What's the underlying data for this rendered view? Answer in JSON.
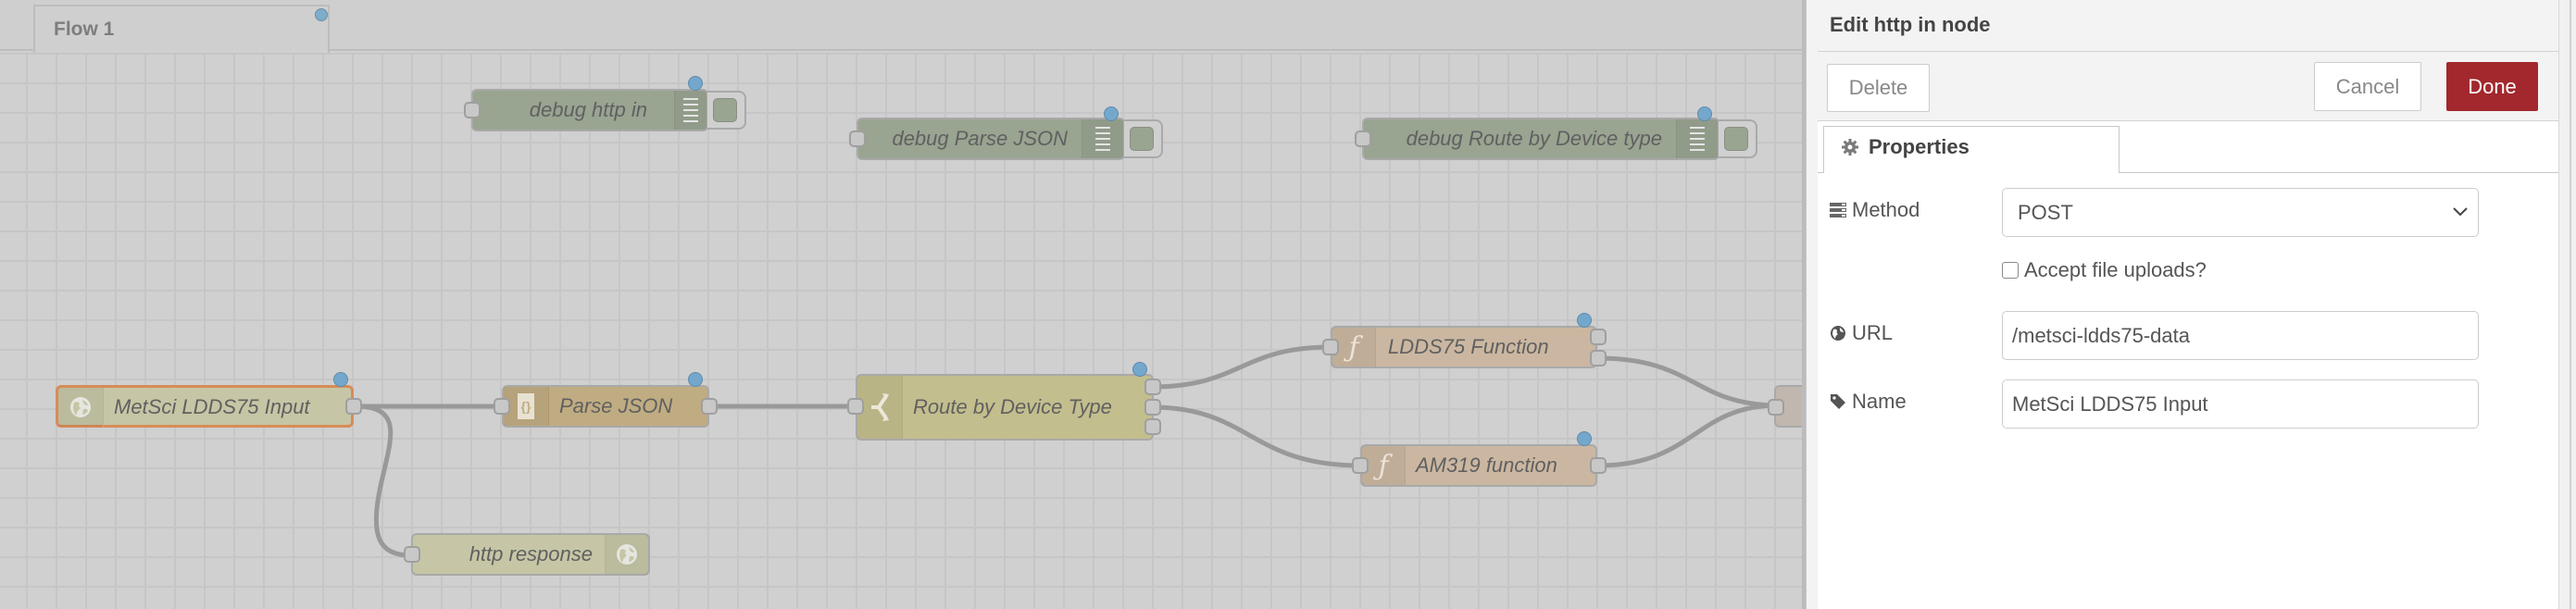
{
  "workspace": {
    "tabs": [
      {
        "label": "Flow 1",
        "changed": true
      }
    ]
  },
  "colors": {
    "canvas": "#d0d0d0",
    "node_http": "#c6c6a6",
    "node_json": "#c0ac82",
    "node_switch": "#c3be8e",
    "node_function": "#cbb7a1",
    "node_debug": "#99a491",
    "selected_border": "#d88c58",
    "status_dot": "#74a7cc",
    "done_button": "#a2282d"
  },
  "nodes": [
    {
      "id": "debug-http-in",
      "label": "debug http in",
      "type": "debug"
    },
    {
      "id": "debug-parse-json",
      "label": "debug Parse JSON",
      "type": "debug"
    },
    {
      "id": "debug-route",
      "label": "debug Route by Device type",
      "type": "debug"
    },
    {
      "id": "http-in",
      "label": "MetSci LDDS75 Input",
      "type": "http in",
      "selected": true
    },
    {
      "id": "parse-json",
      "label": "Parse JSON",
      "type": "json"
    },
    {
      "id": "route",
      "label": "Route by Device Type",
      "type": "switch",
      "outputs": 3
    },
    {
      "id": "ldds75-fn",
      "label": "LDDS75 Function",
      "type": "function",
      "outputs": 2
    },
    {
      "id": "am319-fn",
      "label": "AM319 function",
      "type": "function"
    },
    {
      "id": "http-response",
      "label": "http response",
      "type": "http response"
    }
  ],
  "panel": {
    "title": "Edit http in node",
    "buttons": {
      "delete": "Delete",
      "cancel": "Cancel",
      "done": "Done"
    },
    "tabs": {
      "properties": "Properties"
    },
    "form": {
      "method_label": "Method",
      "method_value": "POST",
      "accept_uploads_label": "Accept file uploads?",
      "accept_uploads_checked": false,
      "url_label": "URL",
      "url_value": "/metsci-ldds75-data",
      "name_label": "Name",
      "name_value": "MetSci LDDS75 Input"
    }
  }
}
